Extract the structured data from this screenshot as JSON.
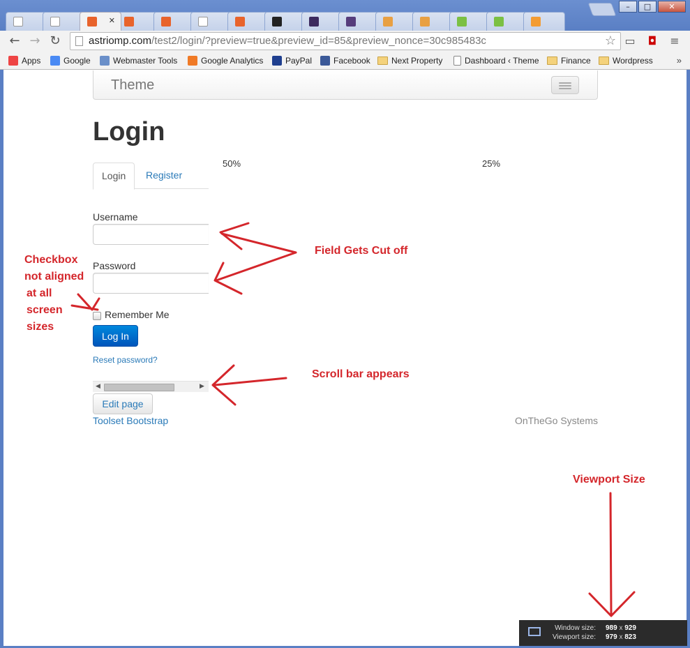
{
  "browser": {
    "window_controls": {
      "minimize": "–",
      "maximize": "□",
      "close": "✕"
    },
    "tabs": [
      {
        "icon": "page-icon",
        "color": "#ffffff"
      },
      {
        "icon": "page-icon",
        "color": "#ffffff"
      },
      {
        "icon": "blogger-icon",
        "color": "#e8632b",
        "active": true
      },
      {
        "icon": "blogger-icon",
        "color": "#e8632b"
      },
      {
        "icon": "blogger-icon",
        "color": "#e8632b"
      },
      {
        "icon": "page-icon",
        "color": "#ffffff"
      },
      {
        "icon": "blogger-icon",
        "color": "#e8632b"
      },
      {
        "icon": "penguin-icon",
        "color": "#222222"
      },
      {
        "icon": "bootstrap-icon",
        "color": "#3c2a5e"
      },
      {
        "icon": "bootstrap-icon",
        "color": "#563d7c"
      },
      {
        "icon": "stackoverflow-icon",
        "color": "#e8a043"
      },
      {
        "icon": "stackoverflow-icon",
        "color": "#e8a043"
      },
      {
        "icon": "w3-icon",
        "color": "#7bc043"
      },
      {
        "icon": "w3-icon",
        "color": "#7bc043"
      },
      {
        "icon": "t-icon",
        "color": "#f39c33"
      }
    ],
    "url_host": "astriomp.com",
    "url_rest": "/test2/login/?preview=true&preview_id=85&preview_nonce=30c985483c",
    "bookmarks": [
      {
        "label": "Apps",
        "icon": "apps-grid-icon",
        "color": "#e44"
      },
      {
        "label": "Google",
        "icon": "google-icon",
        "color": "#4a8af4"
      },
      {
        "label": "Webmaster Tools",
        "icon": "webmaster-icon",
        "color": "#6a8fc9"
      },
      {
        "label": "Google Analytics",
        "icon": "analytics-icon",
        "color": "#f07a26"
      },
      {
        "label": "PayPal",
        "icon": "paypal-icon",
        "color": "#1f3f8f"
      },
      {
        "label": "Facebook",
        "icon": "facebook-icon",
        "color": "#3b5998"
      },
      {
        "label": "Next Property",
        "icon": "folder-icon",
        "color": "#f4d27c"
      },
      {
        "label": "Dashboard ‹ Theme",
        "icon": "doc-icon",
        "color": "#ffffff"
      },
      {
        "label": "Finance",
        "icon": "folder-icon",
        "color": "#f4d27c"
      },
      {
        "label": "Wordpress",
        "icon": "folder-icon",
        "color": "#f4d27c"
      }
    ],
    "more": "»"
  },
  "page": {
    "brand": "Theme",
    "heading": "Login",
    "pct_left": "50%",
    "pct_right": "25%",
    "tabs": {
      "login": "Login",
      "register": "Register"
    },
    "username_label": "Username",
    "password_label": "Password",
    "remember_label": "Remember Me",
    "login_button": "Log In",
    "reset_link": "Reset password?",
    "edit_button": "Edit page",
    "footer_left": "Toolset Bootstrap",
    "footer_right": "OnTheGo Systems"
  },
  "annotations": {
    "field_cut": "Field Gets Cut off",
    "checkbox_line1": "Checkbox",
    "checkbox_line2": "not aligned",
    "checkbox_line3": "at all",
    "checkbox_line4": "screen",
    "checkbox_line5": "sizes",
    "scrollbar": "Scroll bar appears",
    "viewport": "Viewport Size",
    "color": "#d4262b"
  },
  "viewport_badge": {
    "window_label": "Window size:",
    "window_w": "989",
    "window_h": "929",
    "viewport_label": "Viewport size:",
    "viewport_w": "979",
    "viewport_h": "823",
    "times": "x"
  }
}
